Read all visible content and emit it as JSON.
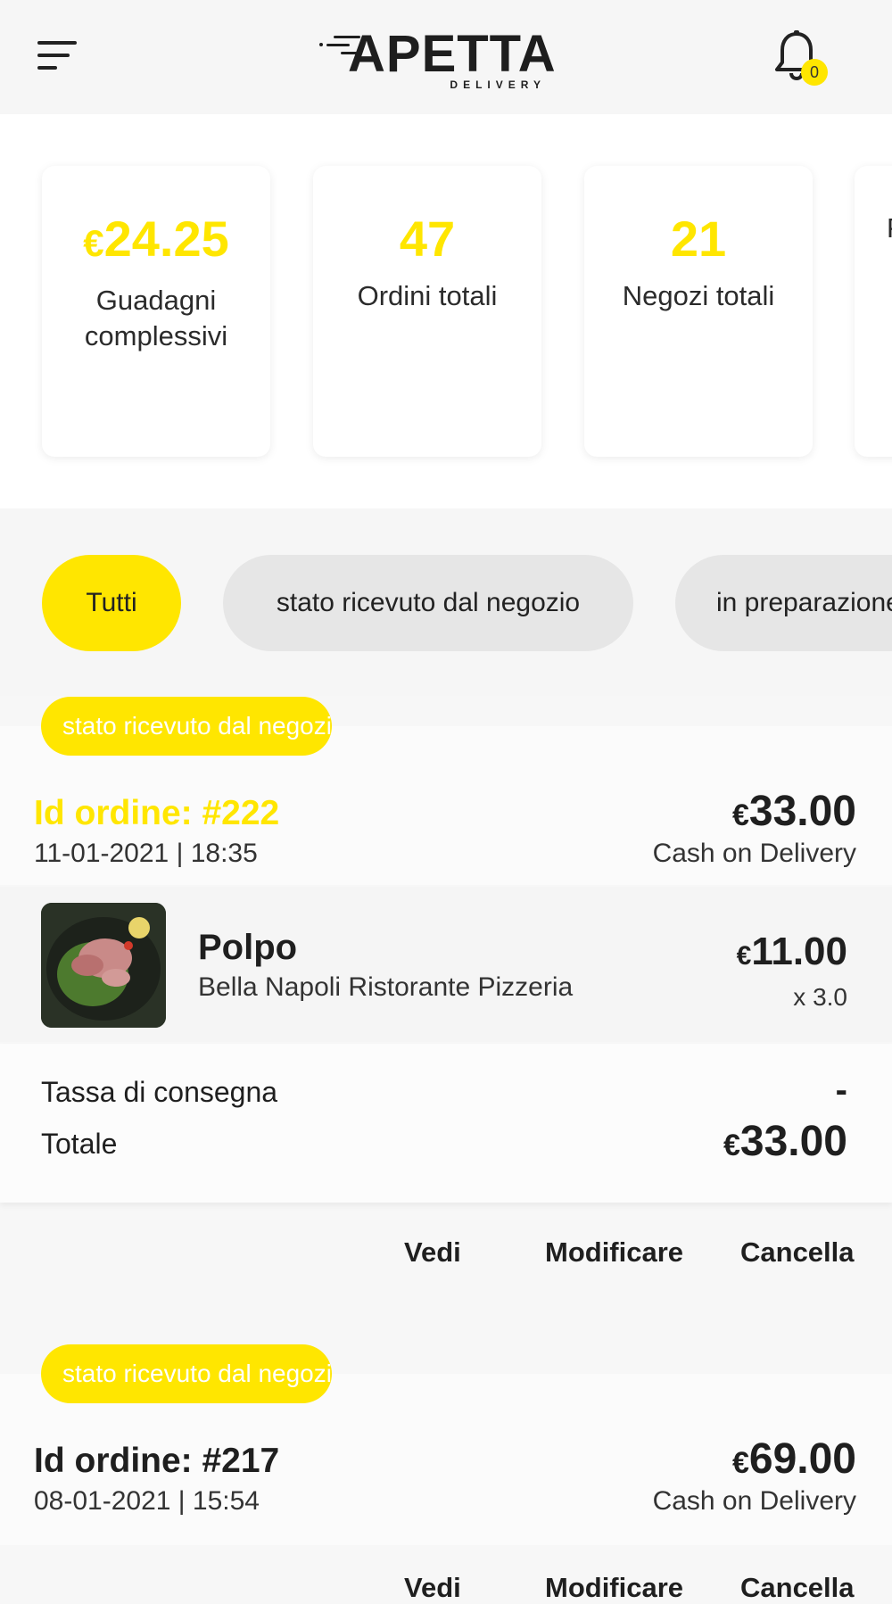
{
  "header": {
    "logo_text": "APETTA",
    "logo_sub": "DELIVERY",
    "notification_count": "0"
  },
  "stats": [
    {
      "currency": "€",
      "value": "24.25",
      "label": "Guadagni complessivi"
    },
    {
      "currency": "",
      "value": "47",
      "label": "Ordini totali"
    },
    {
      "currency": "",
      "value": "21",
      "label": "Negozi totali"
    },
    {
      "currency": "",
      "value": "",
      "label": "P"
    }
  ],
  "filters": [
    {
      "label": "Tutti",
      "active": true
    },
    {
      "label": "stato ricevuto dal negozio",
      "active": false
    },
    {
      "label": "in preparazione",
      "active": false
    }
  ],
  "orders": [
    {
      "status": "stato ricevuto dal negozio",
      "id_label": "Id ordine: #222",
      "datetime": "11-01-2021 | 18:35",
      "currency": "€",
      "total": "33.00",
      "payment": "Cash on Delivery",
      "items": [
        {
          "name": "Polpo",
          "shop": "Bella Napoli Ristorante Pizzeria",
          "currency": "€",
          "price": "11.00",
          "qty": "x 3.0"
        }
      ],
      "delivery_fee_label": "Tassa di consegna",
      "delivery_fee": "-",
      "total_label": "Totale",
      "total_value": "33.00",
      "actions": {
        "view": "Vedi",
        "edit": "Modificare",
        "cancel": "Cancella"
      }
    },
    {
      "status": "stato ricevuto dal negozio",
      "id_label": "Id ordine: #217",
      "datetime": "08-01-2021 | 15:54",
      "currency": "€",
      "total": "69.00",
      "payment": "Cash on Delivery",
      "actions": {
        "view": "Vedi",
        "edit": "Modificare",
        "cancel": "Cancella"
      }
    }
  ],
  "colors": {
    "accent": "#ffe600",
    "text": "#1f1f1f",
    "chip": "#e6e6e6"
  }
}
